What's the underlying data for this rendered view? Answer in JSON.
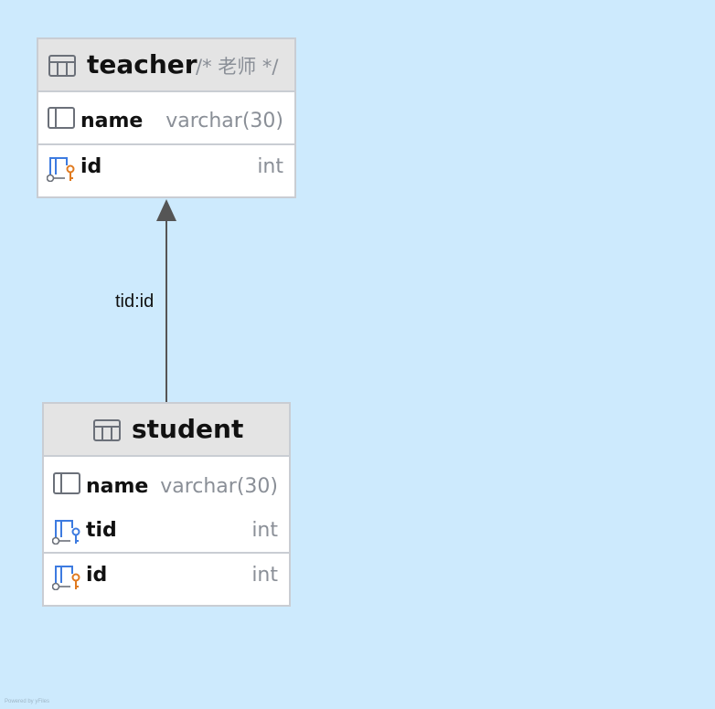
{
  "diagram": {
    "tables": {
      "teacher": {
        "name": "teacher",
        "comment": "/* 老师 */",
        "columns": [
          {
            "name": "name",
            "type": "varchar(30)",
            "icon": "column-icon"
          },
          {
            "name": "id",
            "type": "int",
            "icon": "primary-key-column-icon"
          }
        ]
      },
      "student": {
        "name": "student",
        "columns": [
          {
            "name": "name",
            "type": "varchar(30)",
            "icon": "column-icon"
          },
          {
            "name": "tid",
            "type": "int",
            "icon": "foreign-key-column-icon"
          },
          {
            "name": "id",
            "type": "int",
            "icon": "primary-key-column-icon"
          }
        ]
      }
    },
    "relation": {
      "from": "student",
      "to": "teacher",
      "label": "tid:id"
    },
    "footer": "Powered by yFiles"
  },
  "colors": {
    "background": "#cdeafd",
    "header": "#e4e4e4",
    "border": "#c9cdd3",
    "edge": "#555555",
    "fk_accent": "#3d7be0",
    "pk_accent": "#e07a1f"
  }
}
